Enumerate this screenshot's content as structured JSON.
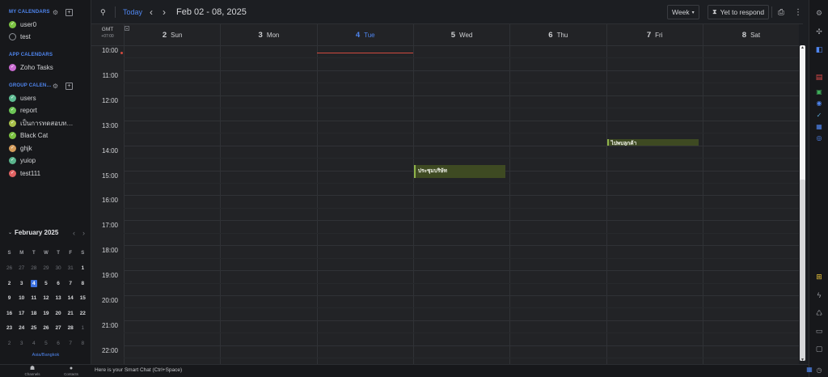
{
  "sidebar": {
    "my_calendars": {
      "title": "MY CALENDARS",
      "items": [
        {
          "label": "user0",
          "checked": true,
          "color": "#7cc242"
        },
        {
          "label": "test",
          "checked": false,
          "color": ""
        }
      ]
    },
    "app_calendars": {
      "title": "APP CALENDARS",
      "items": [
        {
          "label": "Zoho Tasks",
          "checked": true,
          "color": "#c86ad0"
        }
      ]
    },
    "group_calendars": {
      "title": "GROUP CALEN…",
      "items": [
        {
          "label": "users",
          "checked": true,
          "color": "#5dbb92"
        },
        {
          "label": "report",
          "checked": true,
          "color": "#6cc455"
        },
        {
          "label": "เป็นการทดสอบท…",
          "checked": true,
          "color": "#a8c04a"
        },
        {
          "label": "Black Cat",
          "checked": true,
          "color": "#7cc242"
        },
        {
          "label": "ghjk",
          "checked": true,
          "color": "#d49b5a"
        },
        {
          "label": "yuiop",
          "checked": true,
          "color": "#5ab48c"
        },
        {
          "label": "test111",
          "checked": true,
          "color": "#e06262"
        }
      ]
    },
    "mini_calendar": {
      "title": "February 2025",
      "weekday_headers": [
        "S",
        "M",
        "T",
        "W",
        "T",
        "F",
        "S"
      ],
      "weeks": [
        [
          "26",
          "27",
          "28",
          "29",
          "30",
          "31",
          "1"
        ],
        [
          "2",
          "3",
          "4",
          "5",
          "6",
          "7",
          "8"
        ],
        [
          "9",
          "10",
          "11",
          "12",
          "13",
          "14",
          "15"
        ],
        [
          "16",
          "17",
          "18",
          "19",
          "20",
          "21",
          "22"
        ],
        [
          "23",
          "24",
          "25",
          "26",
          "27",
          "28",
          "1"
        ],
        [
          "2",
          "3",
          "4",
          "5",
          "6",
          "7",
          "8"
        ]
      ],
      "dim_cells": [
        [
          0,
          0
        ],
        [
          0,
          1
        ],
        [
          0,
          2
        ],
        [
          0,
          3
        ],
        [
          0,
          4
        ],
        [
          0,
          5
        ],
        [
          4,
          6
        ],
        [
          5,
          0
        ],
        [
          5,
          1
        ],
        [
          5,
          2
        ],
        [
          5,
          3
        ],
        [
          5,
          4
        ],
        [
          5,
          5
        ],
        [
          5,
          6
        ]
      ],
      "today_cell": [
        1,
        2
      ],
      "timezone_link": "Asia/Bangkok"
    },
    "bottom": {
      "channels": "Channels",
      "contacts": "Contacts"
    }
  },
  "toolbar": {
    "today_label": "Today",
    "date_range": "Feb 02 - 08, 2025",
    "view_label": "Week",
    "respond_label": "Yet to respond"
  },
  "grid": {
    "tz_label": "GMT",
    "tz_offset": "+07:00",
    "days": [
      {
        "num": "2",
        "name": "Sun",
        "today": false
      },
      {
        "num": "3",
        "name": "Mon",
        "today": false
      },
      {
        "num": "4",
        "name": "Tue",
        "today": true
      },
      {
        "num": "5",
        "name": "Wed",
        "today": false
      },
      {
        "num": "6",
        "name": "Thu",
        "today": false
      },
      {
        "num": "7",
        "name": "Fri",
        "today": false
      },
      {
        "num": "8",
        "name": "Sat",
        "today": false
      }
    ],
    "hours": [
      "10:00",
      "11:00",
      "12:00",
      "13:00",
      "14:00",
      "15:00",
      "16:00",
      "17:00",
      "18:00",
      "19:00",
      "20:00",
      "21:00",
      "22:00"
    ],
    "first_hour": 10,
    "now_time": 10.3,
    "events": [
      {
        "title": "ประชุมบริษัท",
        "day": 3,
        "start": 14.8,
        "end": 15.3
      },
      {
        "title": "ไปพบลูกค้า",
        "day": 5,
        "start": 13.75,
        "end": 14.0
      }
    ]
  },
  "chat": {
    "placeholder": "Here is your Smart Chat (Ctrl+Space)"
  }
}
